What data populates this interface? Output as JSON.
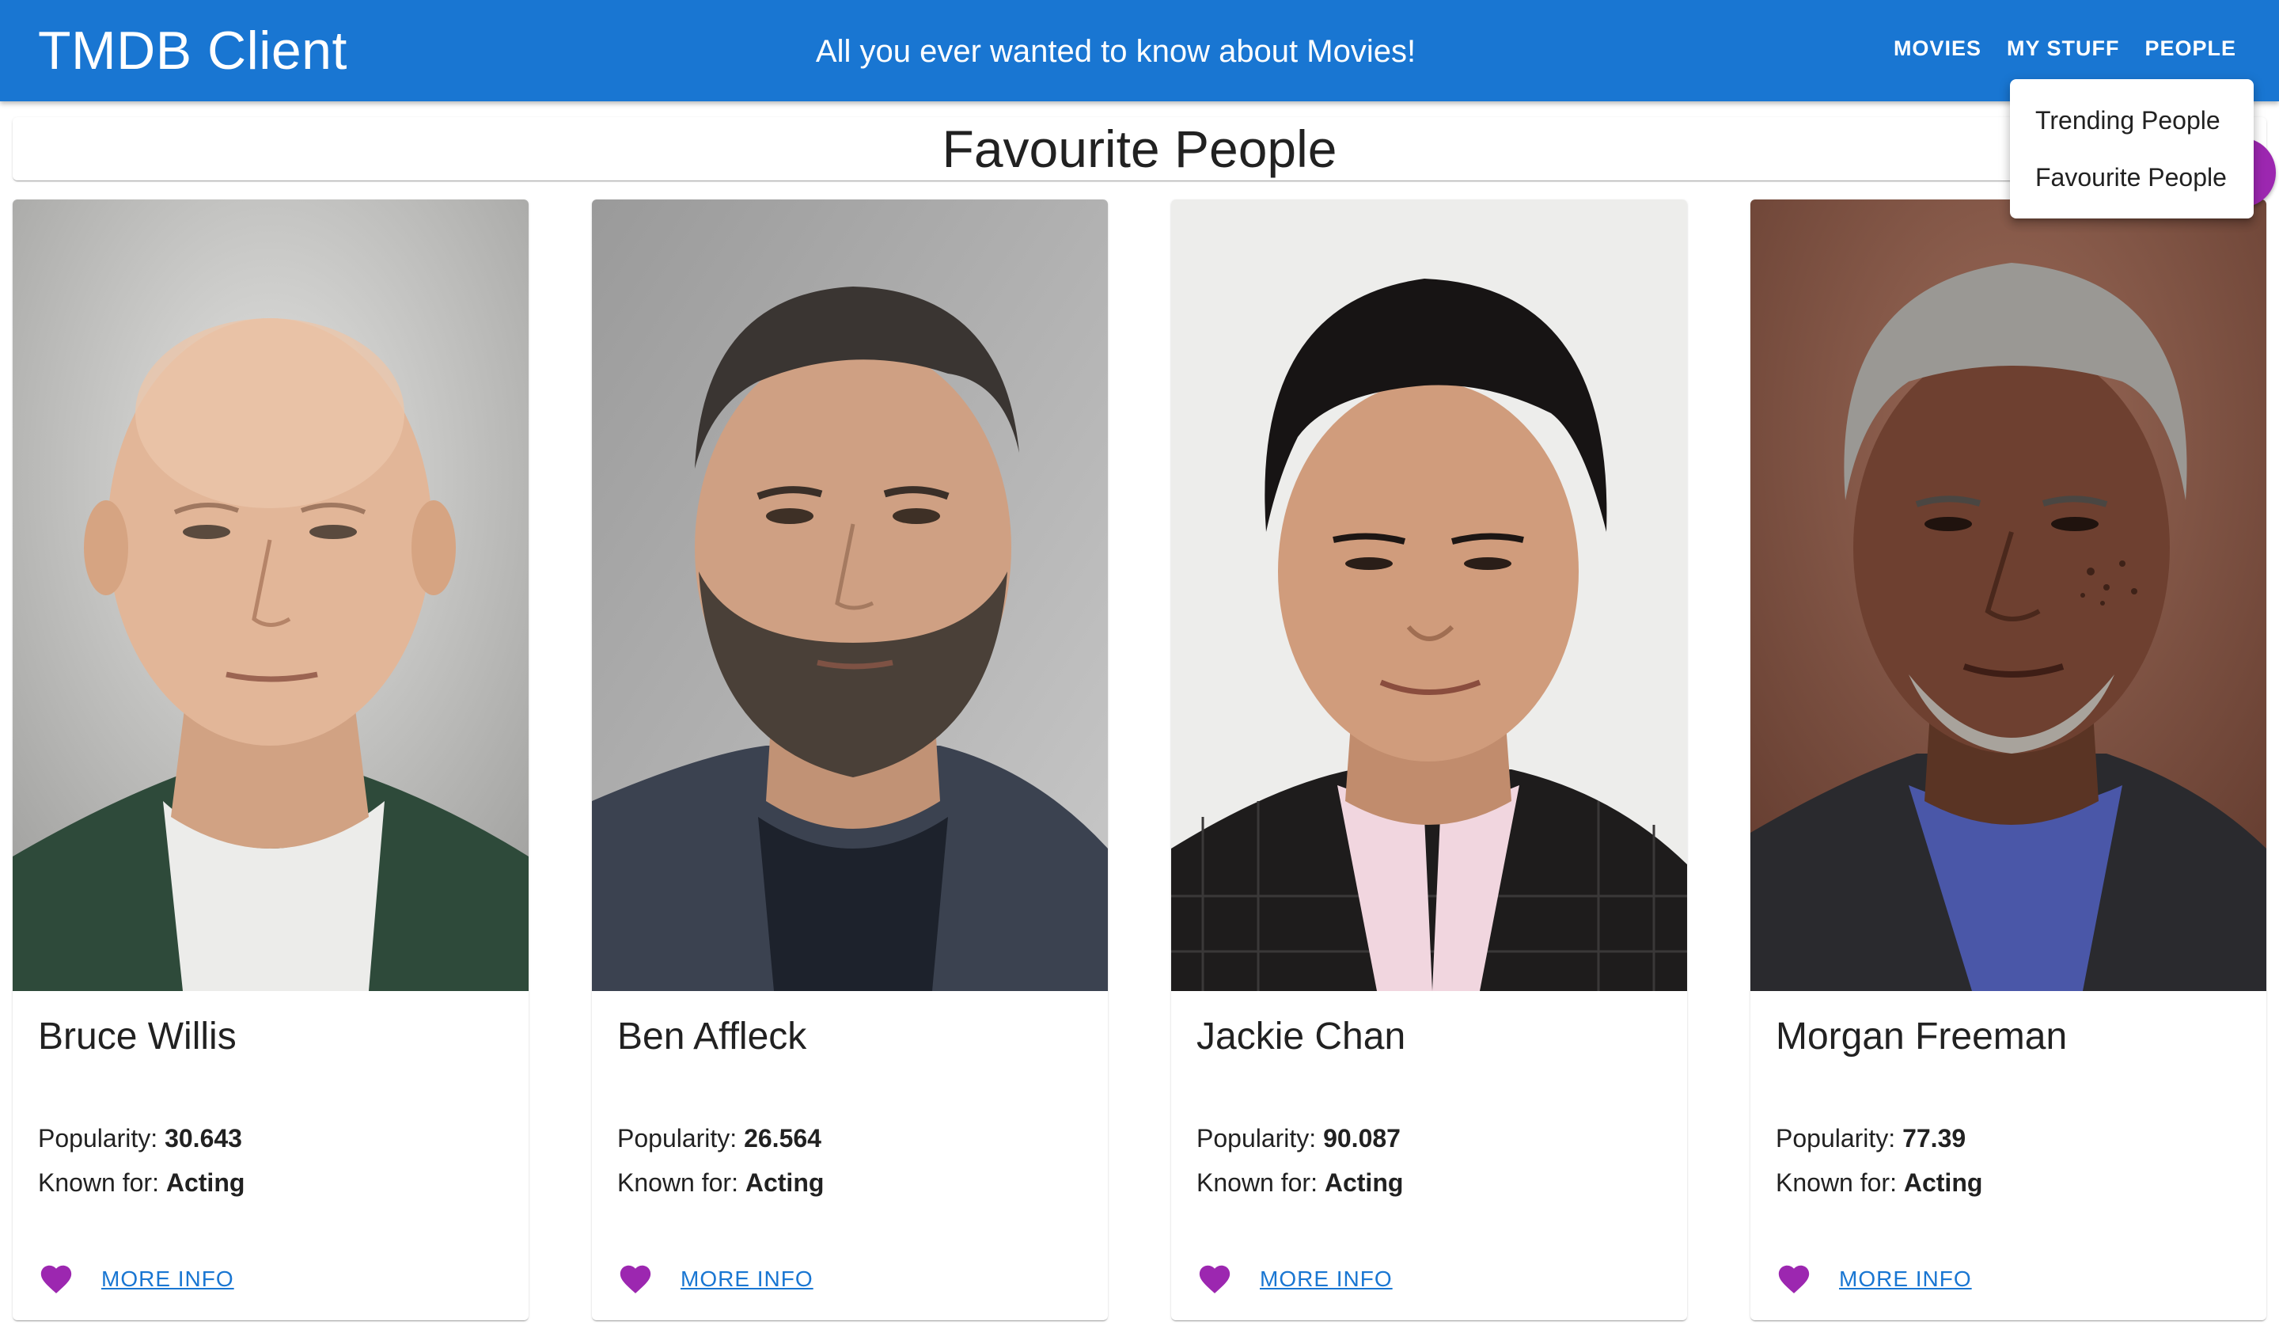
{
  "appbar": {
    "title": "TMDB Client",
    "tagline": "All you ever wanted to know about Movies!",
    "nav": [
      {
        "label": "MOVIES"
      },
      {
        "label": "MY STUFF"
      },
      {
        "label": "PEOPLE"
      }
    ],
    "color": "#1976d2"
  },
  "dropdown": {
    "items": [
      {
        "label": "Trending People"
      },
      {
        "label": "Favourite People"
      }
    ]
  },
  "page": {
    "title": "Favourite People"
  },
  "labels": {
    "popularity": "Popularity:",
    "known_for": "Known for:",
    "more_info": "MORE INFO"
  },
  "people": [
    {
      "name": "Bruce Willis",
      "popularity": "30.643",
      "known_for": "Acting",
      "favourite": true
    },
    {
      "name": "Ben Affleck",
      "popularity": "26.564",
      "known_for": "Acting",
      "favourite": true
    },
    {
      "name": "Jackie Chan",
      "popularity": "90.087",
      "known_for": "Acting",
      "favourite": true
    },
    {
      "name": "Morgan Freeman",
      "popularity": "77.39",
      "known_for": "Acting",
      "favourite": true
    }
  ],
  "colors": {
    "accent": "#9c27b0",
    "link": "#1976d2"
  },
  "icons": {
    "favourite": "heart-icon"
  }
}
